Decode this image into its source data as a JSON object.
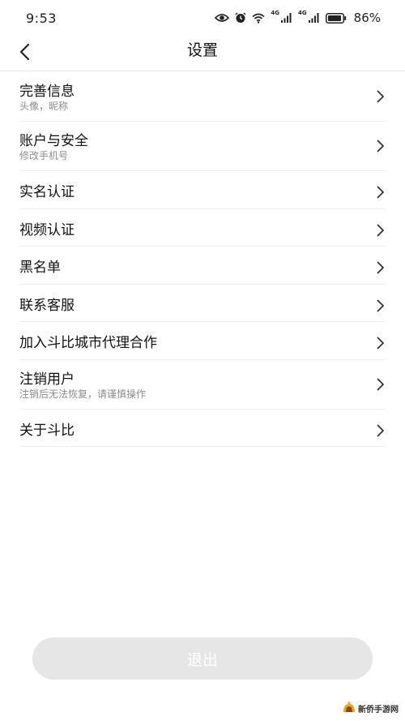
{
  "status_bar": {
    "time": "9:53",
    "battery_percent": "86%",
    "network_1": "4G",
    "network_2": "4G",
    "icons": [
      "eye-icon",
      "alarm-icon",
      "wifi-icon",
      "signal-icon",
      "signal-icon",
      "battery-icon"
    ]
  },
  "header": {
    "title": "设置",
    "back_icon": "chevron-left-icon"
  },
  "settings": {
    "items": [
      {
        "title": "完善信息",
        "subtitle": "头像，昵称"
      },
      {
        "title": "账户与安全",
        "subtitle": "修改手机号"
      },
      {
        "title": "实名认证"
      },
      {
        "title": "视频认证"
      },
      {
        "title": "黑名单"
      },
      {
        "title": "联系客服"
      },
      {
        "title": "加入斗比城市代理合作"
      },
      {
        "title": "注销用户",
        "subtitle": "注销后无法恢复，请谨慎操作"
      },
      {
        "title": "关于斗比"
      }
    ],
    "chevron_icon": "chevron-right-icon"
  },
  "logout": {
    "label": "退出"
  },
  "watermark": {
    "text": "新侨手游网"
  },
  "colors": {
    "background": "#ffffff",
    "divider": "#efefef",
    "subtitle": "#8c8c8c",
    "logout_bg": "#e6e6e6",
    "logout_text": "#ffffff"
  }
}
